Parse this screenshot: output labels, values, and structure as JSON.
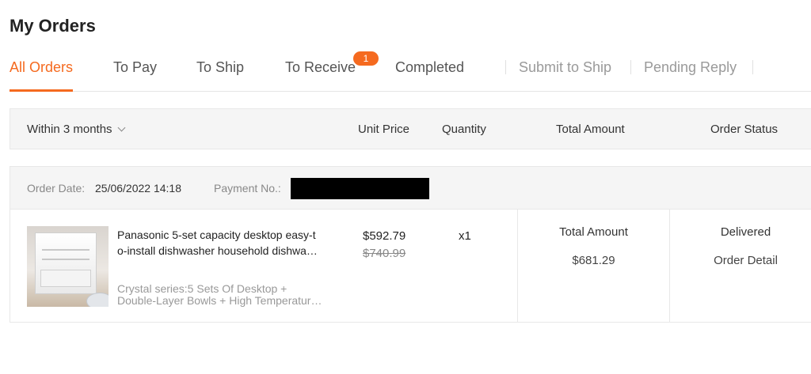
{
  "page": {
    "title": "My Orders"
  },
  "tabs": [
    {
      "label": "All Orders",
      "active": true
    },
    {
      "label": "To Pay"
    },
    {
      "label": "To Ship"
    },
    {
      "label": "To Receive",
      "badge": "1"
    },
    {
      "label": "Completed"
    },
    {
      "label": "Submit to Ship",
      "muted": true
    },
    {
      "label": "Pending Reply",
      "muted": true
    }
  ],
  "colors": {
    "accent": "#f56a1f",
    "muted_text": "#9a9a9a",
    "header_bg": "#f5f5f5"
  },
  "table_header": {
    "filter": "Within 3 months",
    "unit_price": "Unit Price",
    "quantity": "Quantity",
    "total_amount": "Total Amount",
    "order_status": "Order Status"
  },
  "order": {
    "date_label": "Order Date:",
    "date_value": "25/06/2022 14:18",
    "payment_label": "Payment No.:",
    "product": {
      "title_line1": "Panasonic 5-set capacity desktop easy-t",
      "title_line2": "o-install dishwasher household dishwa…",
      "spec_line1": "Crystal series:5 Sets Of Desktop +",
      "spec_line2": "Double-Layer Bowls + High Temperatur…",
      "image_icon": "dishwasher-image"
    },
    "unit_price": "$592.79",
    "original_price": "$740.99",
    "quantity": "x1",
    "total_label": "Total Amount",
    "total_value": "$681.29",
    "status": "Delivered",
    "detail_link": "Order Detail"
  }
}
